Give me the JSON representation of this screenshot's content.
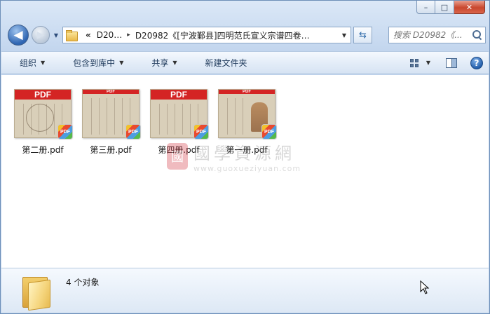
{
  "window": {
    "minimize_glyph": "–",
    "maximize_glyph": "□",
    "close_glyph": "✕"
  },
  "nav": {
    "back_glyph": "◀",
    "forward_glyph": "▶",
    "history_glyph": "▼",
    "breadcrumb_overflow": "«",
    "breadcrumb": [
      "D20…",
      "D20982《[宁波鄞县]四明范氏宣义宗谱四卷…"
    ],
    "breadcrumb_sep": "▸",
    "address_drop_glyph": "▼",
    "refresh_glyph": "⇆",
    "search_placeholder": "搜索 D20982《..."
  },
  "command_bar": {
    "items": [
      {
        "label": "组织",
        "has_menu": true
      },
      {
        "label": "包含到库中",
        "has_menu": true
      },
      {
        "label": "共享",
        "has_menu": true
      },
      {
        "label": "新建文件夹",
        "has_menu": false
      }
    ],
    "menu_caret": "▼",
    "view_drop_glyph": "▼",
    "help_glyph": "?"
  },
  "files": [
    {
      "name": "第二册.pdf",
      "thumb_band": "PDF",
      "thumb_style": "circle"
    },
    {
      "name": "第三册.pdf",
      "thumb_band": "PDF",
      "thumb_style": "text"
    },
    {
      "name": "第四册.pdf",
      "thumb_band": "PDF",
      "thumb_style": "text"
    },
    {
      "name": "第一册.pdf",
      "thumb_band": "PDF",
      "thumb_style": "portrait"
    }
  ],
  "badge_label": "PDF",
  "watermark": {
    "seal": "國",
    "title": "國學資源網",
    "url": "www.guoxueziyuan.com"
  },
  "details": {
    "item_count": "4 个对象"
  },
  "colors": {
    "pdf_red": "#d42424",
    "window_blue": "#c9dbef",
    "command_text": "#1e395b"
  }
}
